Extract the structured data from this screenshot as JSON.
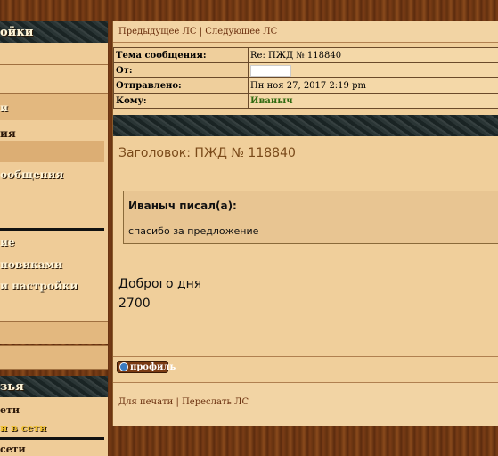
{
  "sidebar": {
    "header1": "ойки",
    "items": [
      {
        "label": "и"
      },
      {
        "label": "ия"
      },
      {
        "label": "ообщения"
      },
      {
        "label": "ие"
      },
      {
        "label": "новиками"
      },
      {
        "label": "и настройки"
      }
    ],
    "header2": "зья",
    "bottom_items": [
      {
        "label": "ети"
      },
      {
        "label": "и в сети"
      },
      {
        "label": "сети"
      }
    ]
  },
  "topnav": {
    "prev": "Предыдущее ЛС",
    "separator": "|",
    "next": "Следующее ЛС"
  },
  "message_header": {
    "subject_label": "Тема сообщения:",
    "subject_value": "Re: ПЖД № 118840",
    "from_label": "От:",
    "sent_label": "Отправлено:",
    "sent_value": "Пн ноя 27, 2017 2:19 pm",
    "to_label": "Кому:",
    "to_value": "Иваныч"
  },
  "message": {
    "title": "Заголовок: ПЖД № 118840",
    "quote_author": "Иваныч писал(а):",
    "quote_text": "спасибо за предложение",
    "body_line1": "Доброго дня",
    "body_line2": "2700"
  },
  "actions": {
    "profile": "профиль",
    "print": "Для печати",
    "separator": "|",
    "forward": "Переслать ЛС"
  },
  "colors": {
    "link": "#6a2f0e",
    "to_value": "#2f6a10"
  }
}
